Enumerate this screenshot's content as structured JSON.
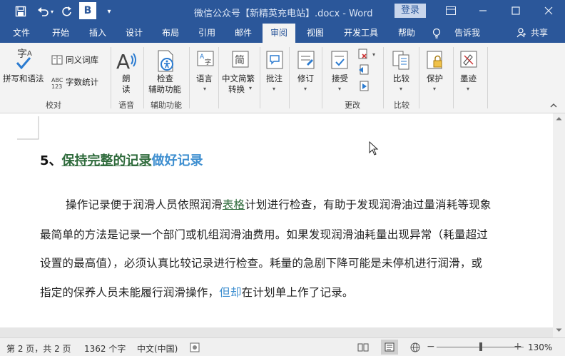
{
  "window": {
    "title": "微信公众号【新精英充电站】.docx  -  Word",
    "login_label": "登录"
  },
  "quick_access": {
    "save_icon": "save-icon",
    "undo_icon": "undo-icon",
    "redo_icon": "redo-icon",
    "bold_label": "B"
  },
  "tabs": [
    "文件",
    "开始",
    "插入",
    "设计",
    "布局",
    "引用",
    "邮件",
    "审阅",
    "视图",
    "开发工具",
    "帮助"
  ],
  "active_tab": "审阅",
  "tell_me": "告诉我",
  "share": "共享",
  "ribbon": {
    "spelling": "拼写和语法",
    "thesaurus": "同义词库",
    "wordcount": "字数统计",
    "read_aloud_1": "朗",
    "read_aloud_2": "读",
    "check_access_1": "检查",
    "check_access_2": "辅助功能",
    "language": "语言",
    "chinese_conv_1": "中文简繁",
    "chinese_conv_2": "转换",
    "comments": "批注",
    "tracking": "修订",
    "accept": "接受",
    "compare": "比较",
    "protect": "保护",
    "ink": "墨迹",
    "groups": {
      "proofing": "校对",
      "speech": "语音",
      "accessibility": "辅助功能",
      "changes": "更改",
      "compare": "比较"
    }
  },
  "document": {
    "heading_prefix": "5、",
    "heading_inserted": "保持完整的记录",
    "heading_blue": "做好记录",
    "line1_a": "操作记录便于润滑人员依照润滑",
    "line1_b": "表格",
    "line1_c": "计划进行检查，有助于发现润滑油过量消耗等现象",
    "line2": "最简单的方法是记录一个部门或机组润滑油费用。如果发现润滑油耗量出现异常（耗量超过",
    "line3": "设置的最高值），必须认真比较记录进行检查。耗量的急剧下降可能是未停机进行润滑，或",
    "line4_a": "指定的保养人员未能履行润滑操作，",
    "line4_b": "但却",
    "line4_c": "在计划单上作了记录。"
  },
  "status": {
    "page": "第 2 页，共 2 页",
    "words": "1362 个字",
    "language": "中文(中国)",
    "zoom": "130%"
  }
}
